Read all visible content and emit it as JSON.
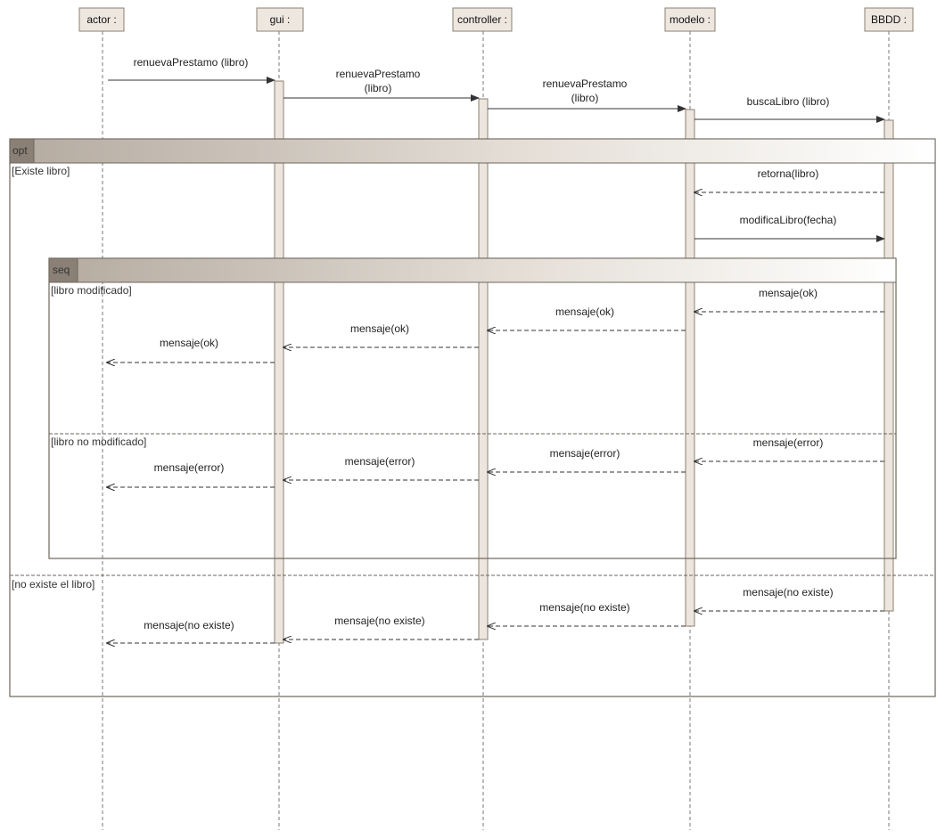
{
  "colors": {
    "lifeline_box": "#ede7df",
    "lifeline_border": "#8c8070",
    "activation": "#ece6de",
    "frame_border": "#6e665c",
    "frame_header_dark": "#8a8076",
    "message": "#333333"
  },
  "lifelines": [
    {
      "id": "actor",
      "label": "actor :"
    },
    {
      "id": "gui",
      "label": "gui :"
    },
    {
      "id": "controller",
      "label": "controller :"
    },
    {
      "id": "modelo",
      "label": "modelo :"
    },
    {
      "id": "bbdd",
      "label": "BBDD :"
    }
  ],
  "fragments": {
    "opt": {
      "operator": "opt",
      "guards": [
        "[Existe libro]",
        "[no existe el libro]"
      ]
    },
    "seq": {
      "operator": "seq",
      "guards": [
        "[libro  modificado]",
        "[libro no modificado]"
      ]
    }
  },
  "messages": [
    {
      "from": "actor",
      "to": "gui",
      "type": "sync",
      "label": "renuevaPrestamo (libro)"
    },
    {
      "from": "gui",
      "to": "controller",
      "type": "sync",
      "label": "renuevaPrestamo\n(libro)"
    },
    {
      "from": "controller",
      "to": "modelo",
      "type": "sync",
      "label": "renuevaPrestamo\n(libro)"
    },
    {
      "from": "modelo",
      "to": "bbdd",
      "type": "sync",
      "label": "buscaLibro (libro)"
    },
    {
      "from": "bbdd",
      "to": "modelo",
      "type": "reply",
      "label": "retorna(libro)"
    },
    {
      "from": "modelo",
      "to": "bbdd",
      "type": "sync",
      "label": "modificaLibro(fecha)"
    },
    {
      "from": "bbdd",
      "to": "modelo",
      "type": "reply",
      "label": "mensaje(ok)"
    },
    {
      "from": "modelo",
      "to": "controller",
      "type": "reply",
      "label": "mensaje(ok)"
    },
    {
      "from": "controller",
      "to": "gui",
      "type": "reply",
      "label": "mensaje(ok)"
    },
    {
      "from": "gui",
      "to": "actor",
      "type": "reply",
      "label": "mensaje(ok)"
    },
    {
      "from": "bbdd",
      "to": "modelo",
      "type": "reply",
      "label": "mensaje(error)"
    },
    {
      "from": "modelo",
      "to": "controller",
      "type": "reply",
      "label": "mensaje(error)"
    },
    {
      "from": "controller",
      "to": "gui",
      "type": "reply",
      "label": "mensaje(error)"
    },
    {
      "from": "gui",
      "to": "actor",
      "type": "reply",
      "label": "mensaje(error)"
    },
    {
      "from": "bbdd",
      "to": "modelo",
      "type": "reply",
      "label": "mensaje(no existe)"
    },
    {
      "from": "modelo",
      "to": "controller",
      "type": "reply",
      "label": "mensaje(no existe)"
    },
    {
      "from": "controller",
      "to": "gui",
      "type": "reply",
      "label": "mensaje(no existe)"
    },
    {
      "from": "gui",
      "to": "actor",
      "type": "reply",
      "label": "mensaje(no existe)"
    }
  ]
}
